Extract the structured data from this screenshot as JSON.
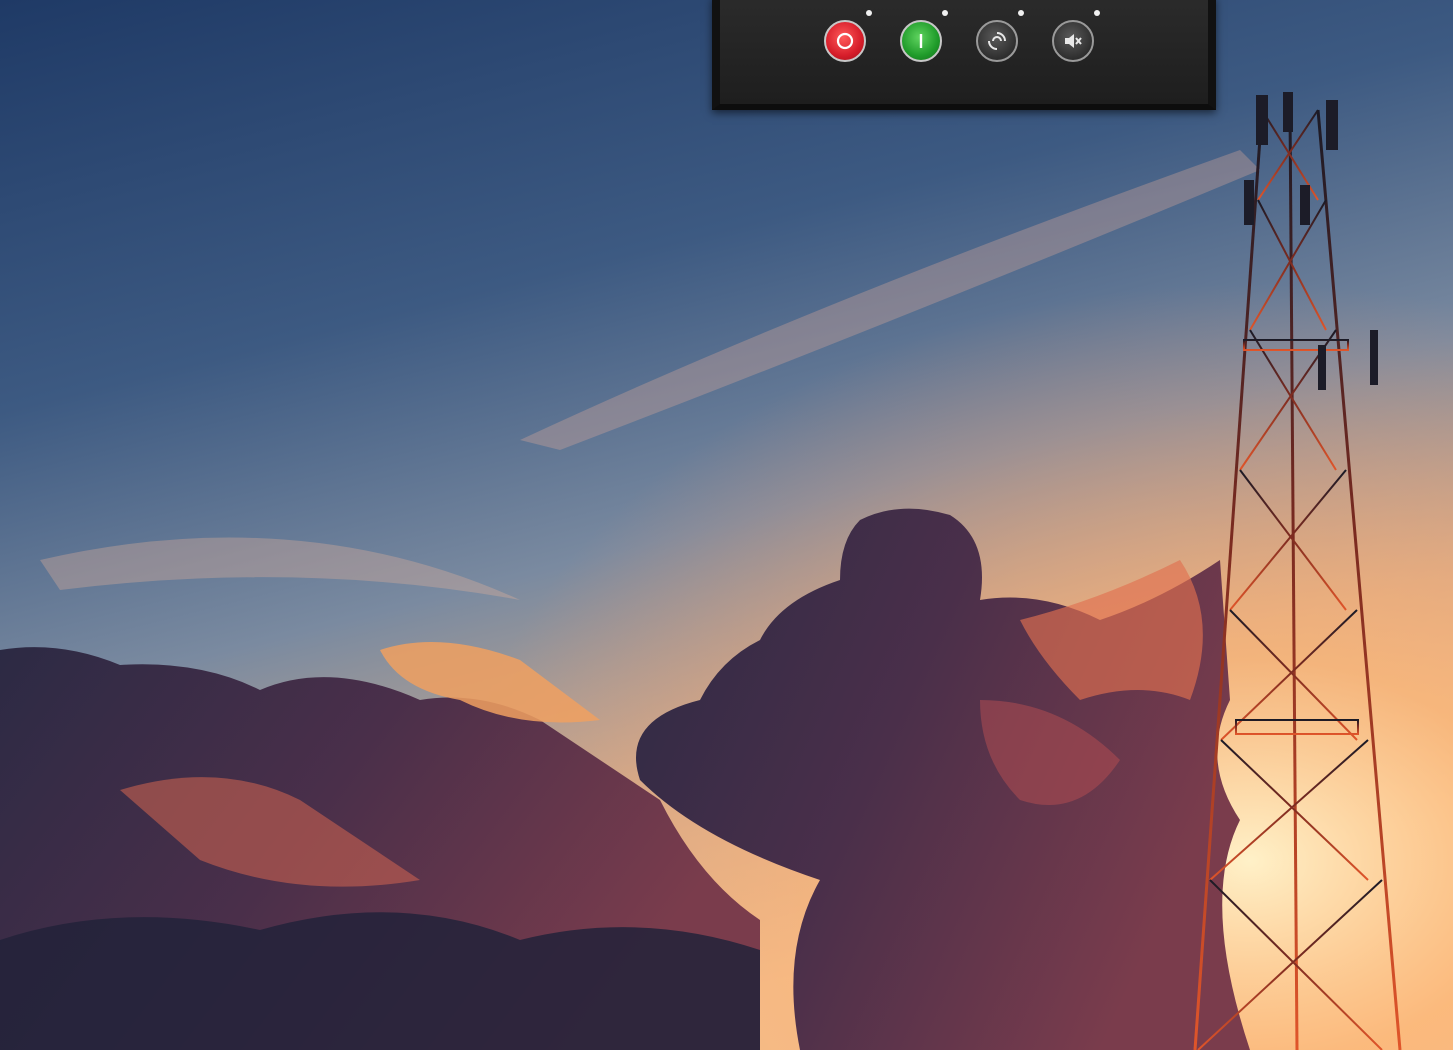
{
  "wallpaper": {
    "description_icon": "sunset-sky-with-cell-tower"
  },
  "control_panel": {
    "buttons": [
      {
        "name": "power-off-icon",
        "color": "#d61d2a"
      },
      {
        "name": "power-on-icon",
        "color": "#1f9b2a"
      },
      {
        "name": "refresh-swirl-icon",
        "color": "#3a3a3a"
      },
      {
        "name": "mute-speaker-icon",
        "color": "#3a3a3a"
      }
    ]
  }
}
